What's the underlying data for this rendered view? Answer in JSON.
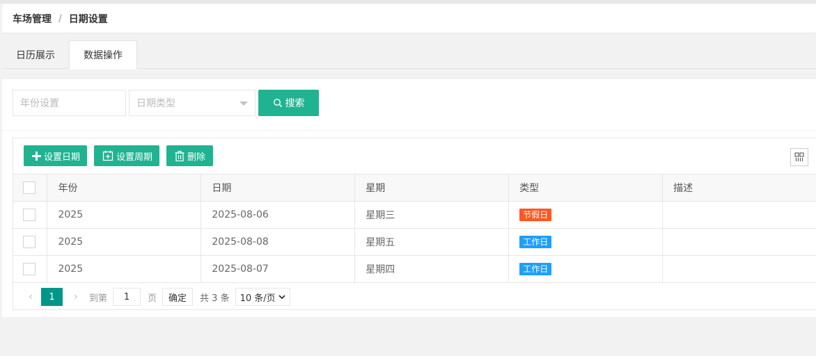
{
  "breadcrumb": {
    "root": "车场管理",
    "separator": "/",
    "current": "日期设置"
  },
  "tabs": [
    {
      "label": "日历展示",
      "active": false
    },
    {
      "label": "数据操作",
      "active": true
    }
  ],
  "search": {
    "year_placeholder": "年份设置",
    "type_placeholder": "日期类型",
    "search_label": "搜索"
  },
  "toolbar": {
    "set_date_label": "设置日期",
    "set_week_label": "设置周期",
    "delete_label": "删除"
  },
  "table": {
    "headers": [
      "年份",
      "日期",
      "星期",
      "类型",
      "描述"
    ],
    "rows": [
      {
        "year": "2025",
        "date": "2025-08-06",
        "weekday": "星期三",
        "type": "节假日",
        "type_color": "#ff5722",
        "desc": ""
      },
      {
        "year": "2025",
        "date": "2025-08-08",
        "weekday": "星期五",
        "type": "工作日",
        "type_color": "#1e9fff",
        "desc": ""
      },
      {
        "year": "2025",
        "date": "2025-08-07",
        "weekday": "星期四",
        "type": "工作日",
        "type_color": "#1e9fff",
        "desc": ""
      }
    ]
  },
  "pager": {
    "prev_icon": "chevron-left-icon",
    "current_page": "1",
    "next_icon": "chevron-right-icon",
    "goto_label": "到第",
    "goto_value": "1",
    "page_unit": "页",
    "confirm_label": "确定",
    "total_text": "共 3 条",
    "page_size": "10 条/页"
  },
  "colors": {
    "primary": "#1fb391",
    "page_active": "#009688",
    "holiday": "#ff5722",
    "workday": "#1e9fff"
  }
}
